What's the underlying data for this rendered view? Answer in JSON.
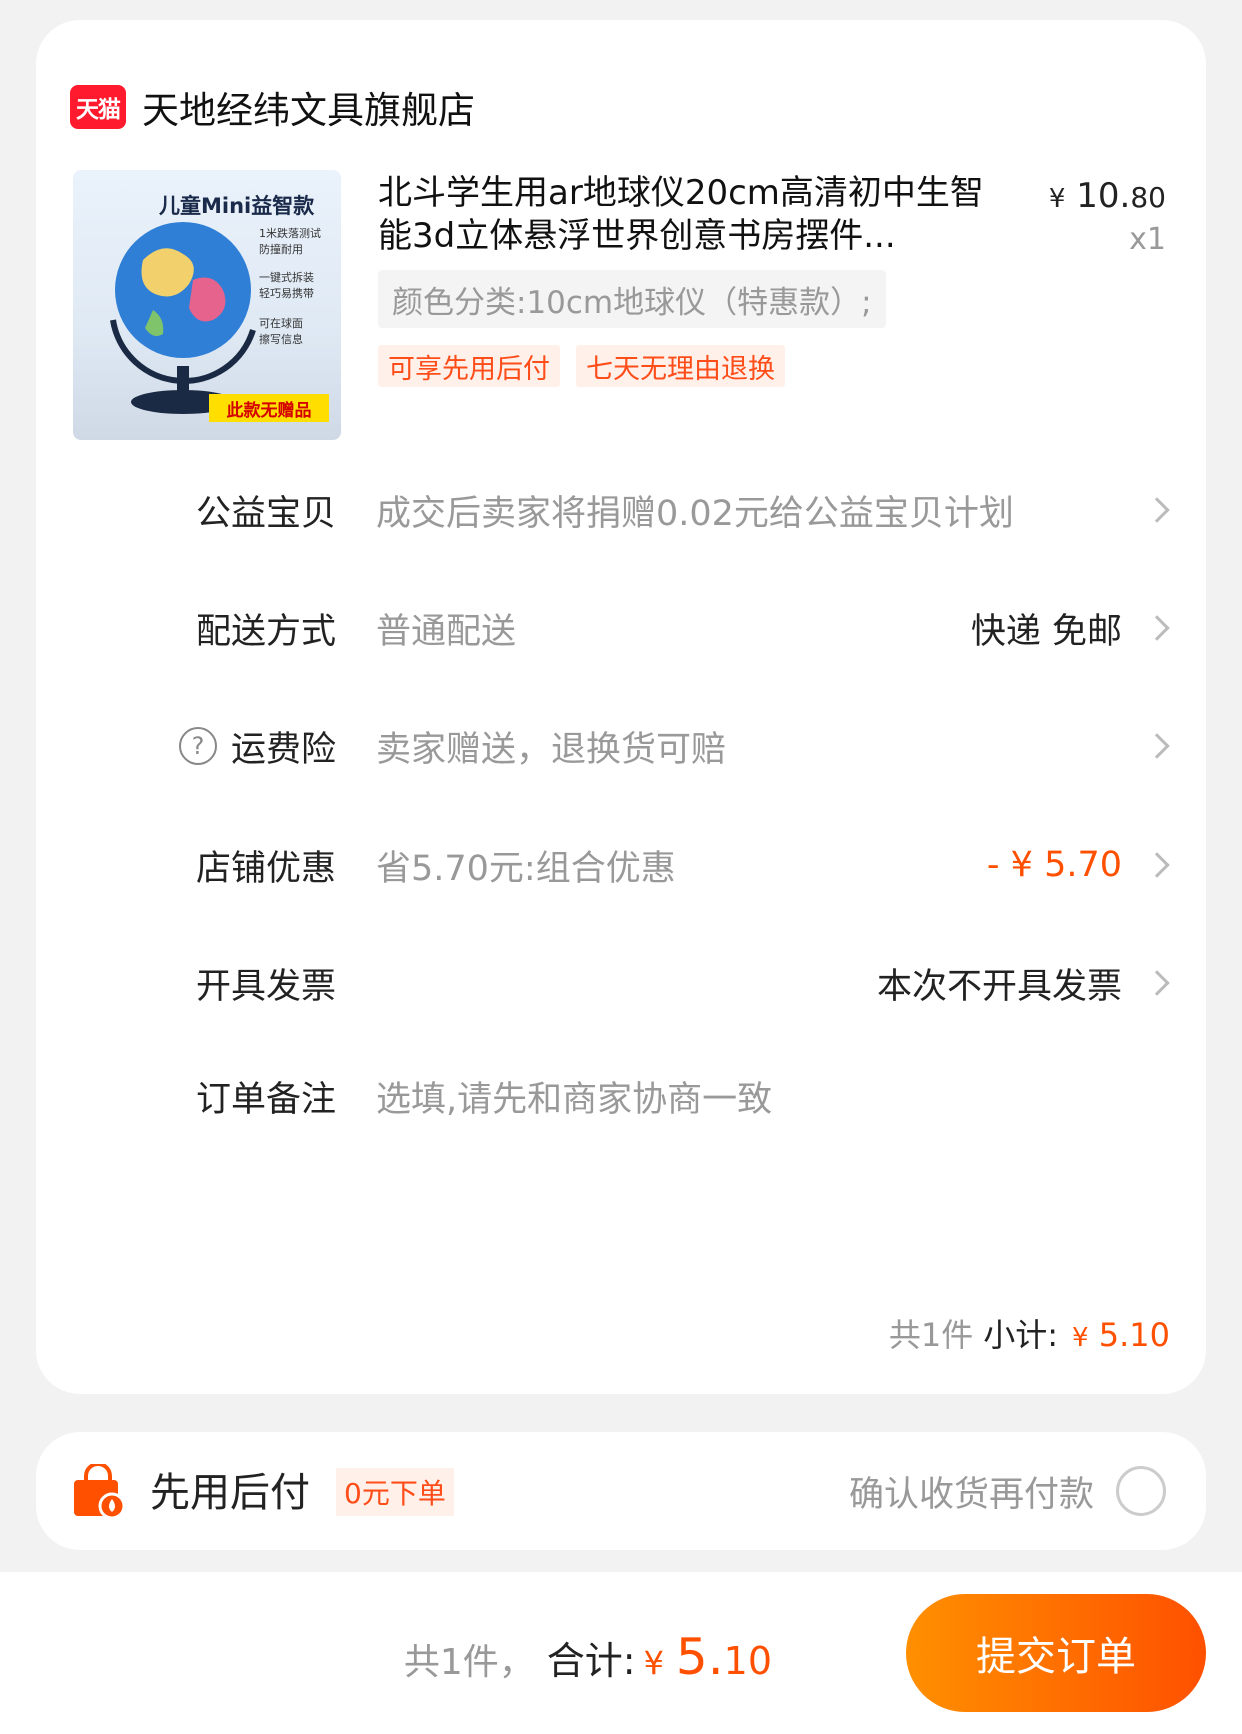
{
  "shop": {
    "name": "天地经纬文具旗舰店",
    "logo_text": "天猫"
  },
  "product": {
    "image_title": "儿童Mini益智款",
    "image_features": [
      "1米跌落测试",
      "防撞耐用",
      "一键式拆装",
      "轻巧易携带",
      "可在球面",
      "擦写信息"
    ],
    "image_badge": "此款无赠品",
    "title": "北斗学生用ar地球仪20cm高清初中生智能3d立体悬浮世界创意书房摆件...",
    "price_currency": "¥",
    "price_int": "10.",
    "price_dec": "80",
    "qty": "x1",
    "sku": "颜色分类:10cm地球仪（特惠款）;",
    "tags": [
      "可享先用后付",
      "七天无理由退换"
    ]
  },
  "rows": {
    "charity": {
      "label": "公益宝贝",
      "desc": "成交后卖家将捐赠0.02元给公益宝贝计划"
    },
    "delivery": {
      "label": "配送方式",
      "desc": "普通配送",
      "value": "快递 免邮"
    },
    "freight": {
      "label": "运费险",
      "desc": "卖家赠送，退换货可赔"
    },
    "discount": {
      "label": "店铺优惠",
      "desc": "省5.70元:组合优惠",
      "value": "- ¥ 5.70"
    },
    "invoice": {
      "label": "开具发票",
      "value": "本次不开具发票"
    },
    "remark": {
      "label": "订单备注",
      "placeholder": "选填,请先和商家协商一致"
    }
  },
  "subtotal": {
    "count": "共1件",
    "label": "小计:",
    "currency": "¥",
    "amount": "5.10"
  },
  "pay_later": {
    "title": "先用后付",
    "badge": "0元下单",
    "note": "确认收货再付款"
  },
  "bottom": {
    "count": "共1件，",
    "label": "合计:",
    "currency": "¥",
    "amount_int": "5.",
    "amount_dec": "10",
    "submit": "提交订单"
  },
  "colors": {
    "accent": "#ff5000",
    "tag_bg": "#fff1ea",
    "tmall_red": "#ff1b2d"
  }
}
